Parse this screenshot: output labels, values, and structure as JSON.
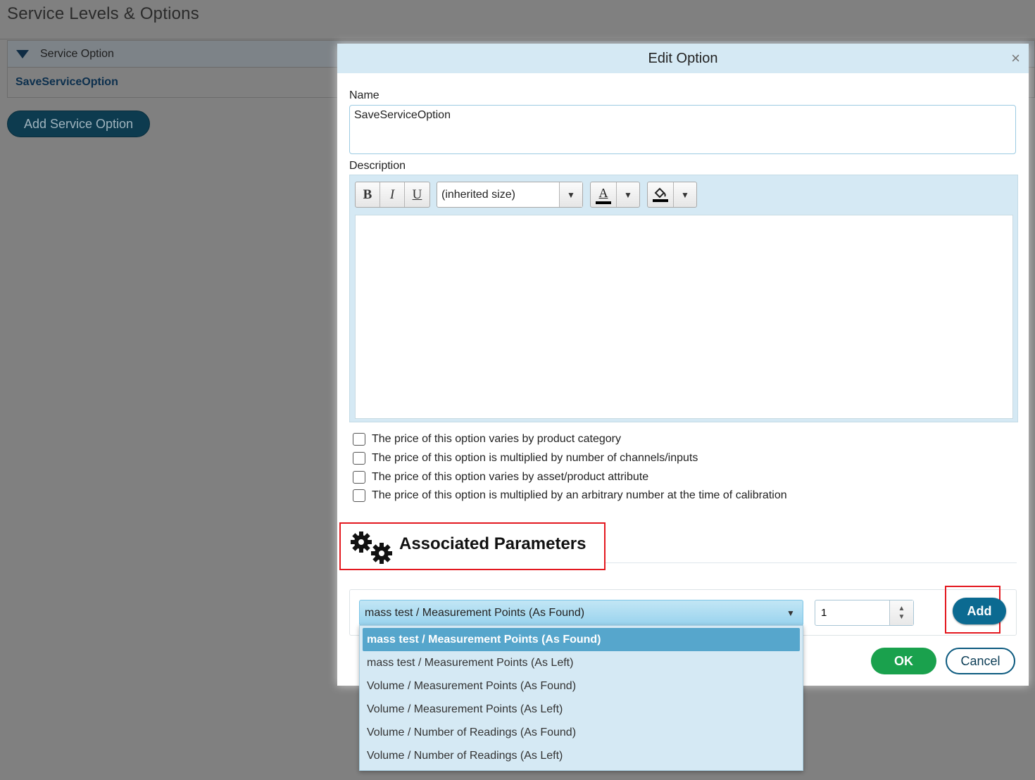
{
  "page": {
    "title": "Service Levels & Options",
    "grid": {
      "column_header": "Service Option",
      "rows": [
        "SaveServiceOption"
      ]
    },
    "add_button": "Add Service Option"
  },
  "modal": {
    "title": "Edit Option",
    "close_glyph": "×",
    "name_label": "Name",
    "name_value": "SaveServiceOption",
    "description_label": "Description",
    "toolbar": {
      "bold": "B",
      "italic": "I",
      "underline": "U",
      "font_size": "(inherited size)",
      "font_color_glyph": "A",
      "dropdown_glyph": "▼"
    },
    "checkboxes": [
      "The price of this option varies by product category",
      "The price of this option is multiplied by number of channels/inputs",
      "The price of this option varies by asset/product attribute",
      "The price of this option is multiplied by an arbitrary number at the time of calibration"
    ],
    "params_title": "Associated Parameters",
    "param_selected": "mass test / Measurement Points (As Found)",
    "quantity": "1",
    "add_label": "Add",
    "ok_label": "OK",
    "cancel_label": "Cancel"
  },
  "dropdown_options": [
    "mass test / Measurement Points (As Found)",
    "mass test / Measurement Points (As Left)",
    "Volume / Measurement Points (As Found)",
    "Volume / Measurement Points (As Left)",
    "Volume / Number of Readings (As Found)",
    "Volume / Number of Readings (As Left)"
  ],
  "colors": {
    "overlay": "#808080",
    "modal_header": "#d5e9f4",
    "primary_button": "#0b6a91",
    "ok_button": "#1aa14d",
    "highlight_border": "#e3181f",
    "selected_option": "#56a6cc"
  }
}
